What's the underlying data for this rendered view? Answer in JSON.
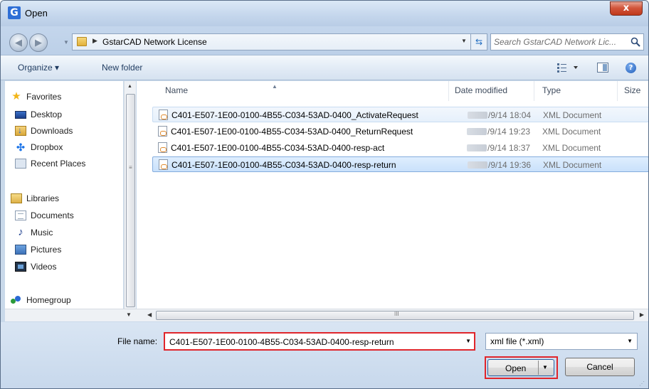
{
  "window": {
    "title": "Open",
    "close_glyph": "x"
  },
  "nav": {
    "breadcrumb": "GstarCAD Network License",
    "search_placeholder": "Search GstarCAD Network Lic..."
  },
  "toolbar": {
    "organize_label": "Organize ▾",
    "new_folder_label": "New folder",
    "help_glyph": "?"
  },
  "sidebar": {
    "favorites_label": "Favorites",
    "favorites": [
      {
        "label": "Desktop",
        "icon": "desktop-icon"
      },
      {
        "label": "Downloads",
        "icon": "downloads-icon"
      },
      {
        "label": "Dropbox",
        "icon": "dropbox-icon"
      },
      {
        "label": "Recent Places",
        "icon": "recent-places-icon"
      }
    ],
    "libraries_label": "Libraries",
    "libraries": [
      {
        "label": "Documents",
        "icon": "documents-icon"
      },
      {
        "label": "Music",
        "icon": "music-icon"
      },
      {
        "label": "Pictures",
        "icon": "pictures-icon"
      },
      {
        "label": "Videos",
        "icon": "videos-icon"
      }
    ],
    "homegroup_label": "Homegroup"
  },
  "filelist": {
    "columns": {
      "name": "Name",
      "date": "Date modified",
      "type": "Type",
      "size": "Size"
    },
    "files": [
      {
        "name": "C401-E507-1E00-0100-4B55-C034-53AD-0400_ActivateRequest",
        "date": "/9/14 18:04",
        "type": "XML Document"
      },
      {
        "name": "C401-E507-1E00-0100-4B55-C034-53AD-0400_ReturnRequest",
        "date": "/9/14 19:23",
        "type": "XML Document"
      },
      {
        "name": "C401-E507-1E00-0100-4B55-C034-53AD-0400-resp-act",
        "date": "/9/14 18:37",
        "type": "XML Document"
      },
      {
        "name": "C401-E507-1E00-0100-4B55-C034-53AD-0400-resp-return",
        "date": "/9/14 19:36",
        "type": "XML Document"
      }
    ],
    "scroll_grip": "III"
  },
  "footer": {
    "file_name_label": "File name:",
    "file_name_value": "C401-E507-1E00-0100-4B55-C034-53AD-0400-resp-return",
    "file_type_value": "xml file (*.xml)",
    "open_label": "Open",
    "cancel_label": "Cancel"
  },
  "colors": {
    "highlight_border": "#e0252b",
    "selection": "#c9e1fb",
    "chrome": "#c9d9ea"
  }
}
